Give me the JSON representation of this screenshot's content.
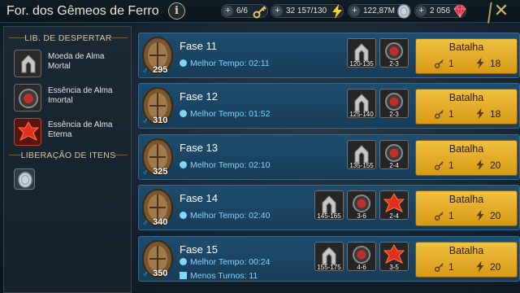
{
  "header": {
    "title": "For. dos Gêmeos de Ferro",
    "info_label": "i",
    "resources": [
      {
        "name": "keys",
        "value": "6/6",
        "icon": "key-icon",
        "color": "#e8c466"
      },
      {
        "name": "energy",
        "value": "32 157/130",
        "icon": "lightning-icon",
        "color": "#f5d22c"
      },
      {
        "name": "silver",
        "value": "122,87M",
        "icon": "silver-coin-icon",
        "color": "#c9d3dd"
      },
      {
        "name": "gems",
        "value": "2 056",
        "icon": "ruby-icon",
        "color": "#e0243a"
      }
    ],
    "close_label": "✕"
  },
  "sidebar": {
    "awaken_title": "LIB. DE DESPERTAR",
    "awaken_items": [
      {
        "label": "Moeda de Alma Mortal",
        "icon": "mortal-soul-coin-icon",
        "color": "#9a9a9a"
      },
      {
        "label": "Essência de Alma Imortal",
        "icon": "immortal-soul-essence-icon",
        "color": "#c0302a"
      },
      {
        "label": "Essência de Alma Eterna",
        "icon": "eternal-soul-essence-icon",
        "color": "#e23020"
      }
    ],
    "items_title": "LIBERAÇÃO DE ITENS",
    "items": [
      {
        "icon": "silver-coin-icon",
        "color": "#c9d3dd"
      }
    ]
  },
  "stages": [
    {
      "name": "Fase 11",
      "level": "295",
      "best_time": "Melhor Tempo: 02:11",
      "min_turns": "",
      "rewards": [
        {
          "type": "mortal",
          "label": "120-135"
        },
        {
          "type": "immortal",
          "label": "2-3"
        }
      ],
      "battle": {
        "label": "Batalha",
        "key_cost": "1",
        "energy_cost": "18"
      }
    },
    {
      "name": "Fase 12",
      "level": "310",
      "best_time": "Melhor Tempo: 01:52",
      "min_turns": "",
      "rewards": [
        {
          "type": "mortal",
          "label": "125-140"
        },
        {
          "type": "immortal",
          "label": "2-3"
        }
      ],
      "battle": {
        "label": "Batalha",
        "key_cost": "1",
        "energy_cost": "18"
      }
    },
    {
      "name": "Fase 13",
      "level": "325",
      "best_time": "Melhor Tempo: 02:10",
      "min_turns": "",
      "rewards": [
        {
          "type": "mortal",
          "label": "135-155"
        },
        {
          "type": "immortal",
          "label": "2-4"
        }
      ],
      "battle": {
        "label": "Batalha",
        "key_cost": "1",
        "energy_cost": "20"
      }
    },
    {
      "name": "Fase 14",
      "level": "340",
      "best_time": "Melhor Tempo: 02:40",
      "min_turns": "",
      "rewards": [
        {
          "type": "mortal",
          "label": "145-165"
        },
        {
          "type": "immortal",
          "label": "3-6"
        },
        {
          "type": "eternal",
          "label": "2-4"
        }
      ],
      "battle": {
        "label": "Batalha",
        "key_cost": "1",
        "energy_cost": "20"
      }
    },
    {
      "name": "Fase 15",
      "level": "350",
      "best_time": "Melhor Tempo: 00:24",
      "min_turns": "Menos Turnos: 11",
      "rewards": [
        {
          "type": "mortal",
          "label": "155-175"
        },
        {
          "type": "immortal",
          "label": "4-6"
        },
        {
          "type": "eternal",
          "label": "3-5"
        }
      ],
      "battle": {
        "label": "Batalha",
        "key_cost": "1",
        "energy_cost": "20"
      }
    }
  ]
}
